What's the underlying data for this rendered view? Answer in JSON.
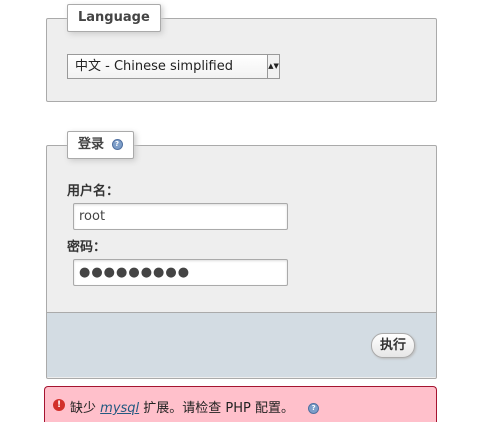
{
  "language_section": {
    "legend": "Language",
    "selected_language": "中文 - Chinese simplified",
    "dropdown_arrow": "▲▼"
  },
  "login_section": {
    "legend": "登录",
    "username_label": "用户名：",
    "username_value": "root",
    "password_label": "密码：",
    "password_value": "●●●●●●●●●",
    "submit_label": "执行",
    "help_glyph": "?"
  },
  "error": {
    "icon_glyph": "!",
    "prefix": "缺少",
    "link_text": "mysql",
    "suffix": "扩展。请检查 PHP 配置。",
    "help_glyph": "?"
  },
  "colors": {
    "fieldset_bg": "#eeeeee",
    "footer_bar_bg": "#d3dce3",
    "error_bg": "#ffc0cb",
    "error_border": "#a51430",
    "link_color": "#235a81"
  }
}
